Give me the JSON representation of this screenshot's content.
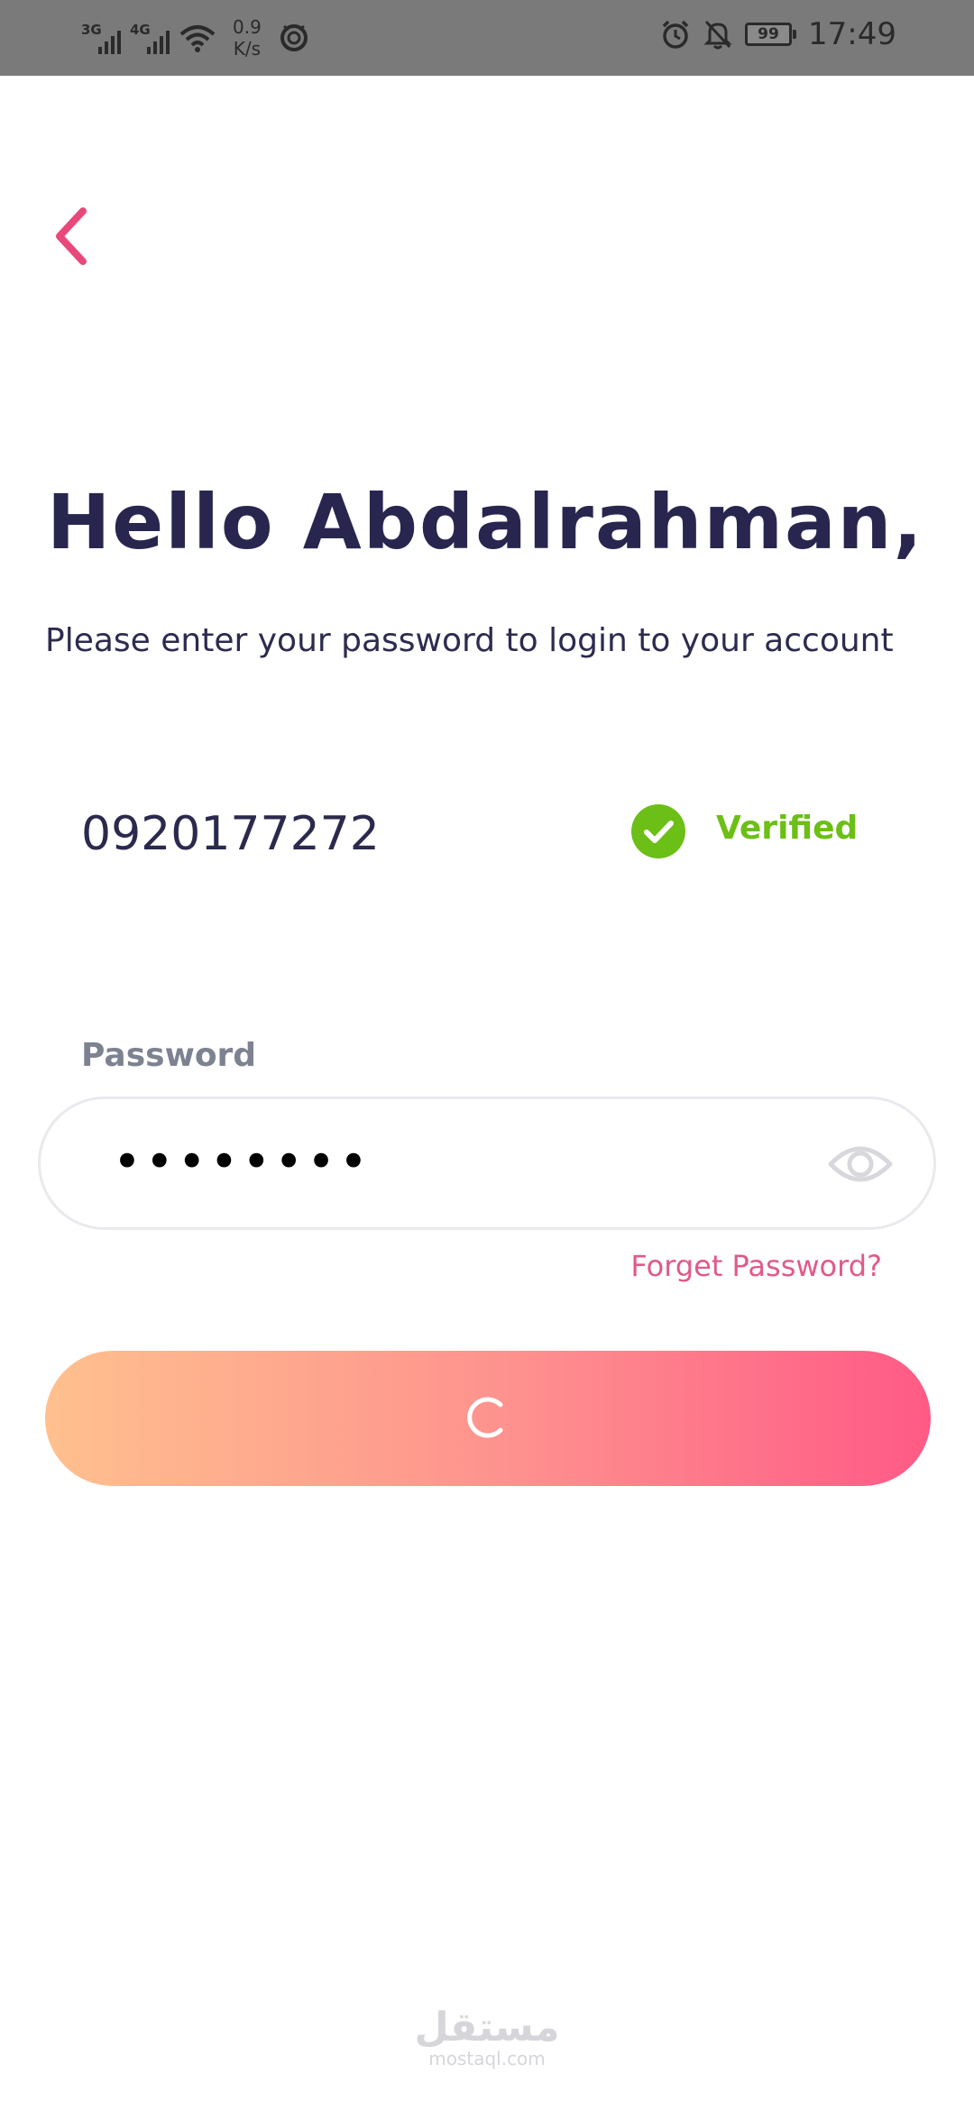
{
  "status_bar": {
    "signal_1_type": "3G",
    "signal_2_type": "4G",
    "speed_value": "0.9",
    "speed_unit": "K/s",
    "battery_level": "99",
    "time": "17:49"
  },
  "greeting": "Hello Abdalrahman,",
  "subtitle": "Please enter your password to login to your account",
  "phone": {
    "number": "0920177272",
    "status_label": "Verified"
  },
  "password": {
    "label": "Password",
    "masked_value": "••••••••"
  },
  "forget_password_label": "Forget Password?",
  "watermark": {
    "arabic": "مستقل",
    "domain": "mostaql.com"
  },
  "colors": {
    "accent_pink": "#e9487a",
    "title_navy": "#28264f",
    "verified_green": "#6cbf16",
    "button_gradient_start": "#ffc08e",
    "button_gradient_end": "#ff5a86"
  }
}
